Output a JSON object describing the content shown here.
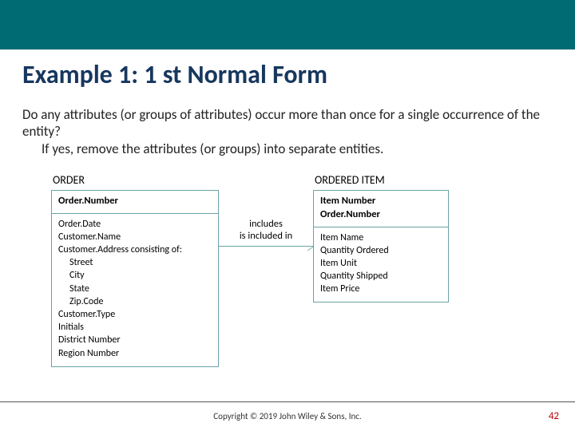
{
  "title": "Example 1: 1 st Normal Form",
  "body": {
    "q": "Do any attributes (or groups of attributes) occur more than once for a single occurrence of the entity?",
    "a": "If yes, remove the attributes (or groups) into separate entities."
  },
  "entities": {
    "left": {
      "name": "ORDER",
      "pk": [
        "Order.Number"
      ],
      "attrs": [
        {
          "t": "Order.Date"
        },
        {
          "t": "Customer.Name"
        },
        {
          "t": "Customer.Address consisting of:"
        },
        {
          "t": "Street",
          "sub": true
        },
        {
          "t": "City",
          "sub": true
        },
        {
          "t": "State",
          "sub": true
        },
        {
          "t": "Zip.Code",
          "sub": true
        },
        {
          "t": "Customer.Type"
        },
        {
          "t": "Initials"
        },
        {
          "t": "District Number"
        },
        {
          "t": "Region Number"
        }
      ]
    },
    "right": {
      "name": "ORDERED ITEM",
      "pk": [
        "Item Number",
        "Order.Number"
      ],
      "attrs": [
        {
          "t": "Item Name"
        },
        {
          "t": "Quantity Ordered"
        },
        {
          "t": "Item Unit"
        },
        {
          "t": "Quantity Shipped"
        },
        {
          "t": "Item Price"
        }
      ]
    }
  },
  "relationship": {
    "top": "includes",
    "bottom": "is included in"
  },
  "footer": {
    "copyright": "Copyright © 2019 John Wiley & Sons, Inc.",
    "page": "42"
  }
}
